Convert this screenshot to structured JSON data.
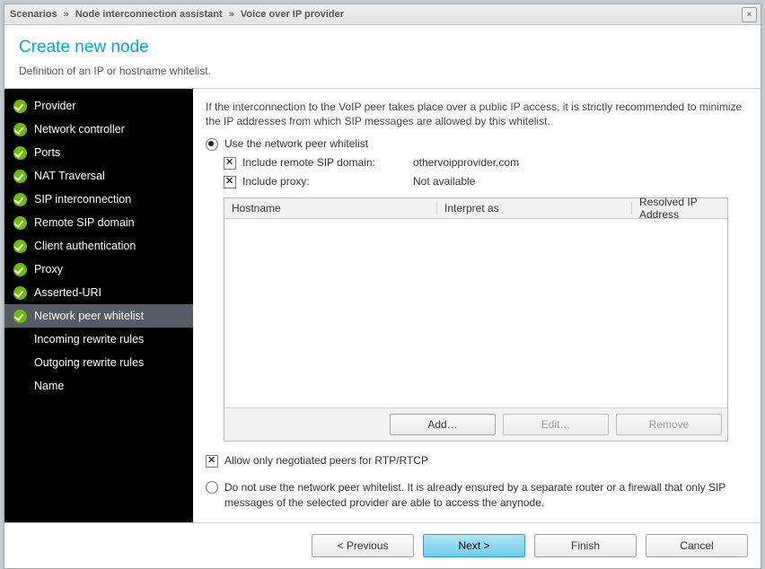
{
  "breadcrumb": [
    "Scenarios",
    "Node interconnection assistant",
    "Voice over IP provider"
  ],
  "closeGlyph": "×",
  "header": {
    "title": "Create new node",
    "subtitle": "Definition of an IP or hostname whitelist."
  },
  "sidebar": [
    {
      "label": "Provider",
      "done": true,
      "active": false
    },
    {
      "label": "Network controller",
      "done": true,
      "active": false
    },
    {
      "label": "Ports",
      "done": true,
      "active": false
    },
    {
      "label": "NAT Traversal",
      "done": true,
      "active": false
    },
    {
      "label": "SIP interconnection",
      "done": true,
      "active": false
    },
    {
      "label": "Remote SIP domain",
      "done": true,
      "active": false
    },
    {
      "label": "Client authentication",
      "done": true,
      "active": false
    },
    {
      "label": "Proxy",
      "done": true,
      "active": false
    },
    {
      "label": "Asserted-URI",
      "done": true,
      "active": false
    },
    {
      "label": "Network peer whitelist",
      "done": true,
      "active": true
    },
    {
      "label": "Incoming rewrite rules",
      "done": false,
      "active": false
    },
    {
      "label": "Outgoing rewrite rules",
      "done": false,
      "active": false
    },
    {
      "label": "Name",
      "done": false,
      "active": false
    }
  ],
  "content": {
    "intro": "If the interconnection to the VoIP peer takes place over a public IP access, it is strictly recommended to minimize the IP addresses from which SIP messages are allowed by this whitelist.",
    "opt1": "Use the network peer whitelist",
    "include_sip_domain_label": "Include remote SIP domain:",
    "include_sip_domain_value": "othervoipprovider.com",
    "include_proxy_label": "Include proxy:",
    "include_proxy_value": "Not available",
    "table": {
      "cols": [
        "Hostname",
        "Interpret as",
        "Resolved IP Address"
      ],
      "buttons": {
        "add": "Add…",
        "edit": "Edit…",
        "remove": "Remove"
      }
    },
    "rtp_check": "Allow only negotiated peers for RTP/RTCP",
    "opt2": "Do not use the network peer whitelist. It is already ensured by a separate router or a firewall that only SIP messages of the selected provider are able to access the anynode."
  },
  "footer": {
    "prev": "< Previous",
    "next": "Next >",
    "finish": "Finish",
    "cancel": "Cancel"
  }
}
